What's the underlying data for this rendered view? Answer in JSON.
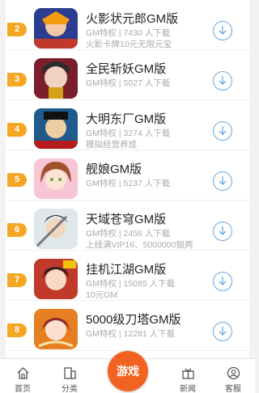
{
  "games": [
    {
      "rank": "2",
      "name": "火影状元郎GM版",
      "meta": "GM特权 | 7430 人下载",
      "desc": "火影卡牌10元无限元宝",
      "icon": "ninja-game-icon"
    },
    {
      "rank": "3",
      "name": "全民斩妖GM版",
      "meta": "GM特权 | 5027 人下载",
      "desc": "",
      "icon": "demon-slayer-game-icon"
    },
    {
      "rank": "4",
      "name": "大明东厂GM版",
      "meta": "GM特权 | 3274 人下载",
      "desc": "模拟经营养成",
      "icon": "ming-dynasty-game-icon"
    },
    {
      "rank": "5",
      "name": "舰娘GM版",
      "meta": "GM特权 | 5237 人下载",
      "desc": "",
      "icon": "anime-girl-game-icon"
    },
    {
      "rank": "6",
      "name": "天域苍穹GM版",
      "meta": "GM特权 | 2456 人下载",
      "desc": "上线满VIP16、5000000银两",
      "icon": "swordsman-game-icon"
    },
    {
      "rank": "7",
      "name": "挂机江湖GM版",
      "meta": "GM特权 | 15085 人下载",
      "desc": "10元GM",
      "icon": "jianghu-game-icon"
    },
    {
      "rank": "8",
      "name": "5000级刀塔GM版",
      "meta": "GM特权 | 12281 人下载",
      "desc": "",
      "icon": "dota-game-icon"
    }
  ],
  "tabbar": {
    "home": "首页",
    "category": "分类",
    "game": "游戏",
    "news": "新闻",
    "service": "客服"
  },
  "colors": {
    "rank_badge": "#f5a623",
    "download_icon": "#6aa7dc",
    "game_button": "#f26322"
  }
}
